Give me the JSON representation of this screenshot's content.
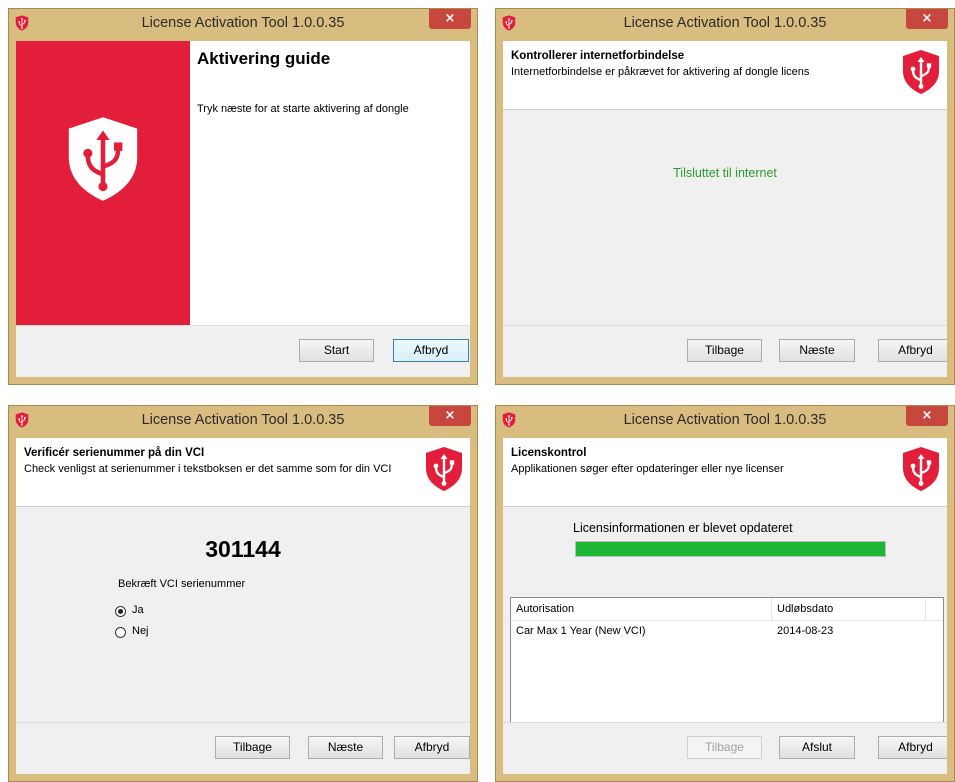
{
  "colors": {
    "brand_red": "#e31e3a",
    "progress_green": "#1db534",
    "status_green": "#2a9b2a"
  },
  "window_title": "License Activation Tool 1.0.0.35",
  "close_glyph": "×",
  "windows": [
    {
      "heading": "Aktivering guide",
      "body": "Tryk næste for at starte aktivering af dongle",
      "buttons": {
        "start": "Start",
        "cancel": "Afbryd"
      }
    },
    {
      "header_title": "Kontrollerer internetforbindelse",
      "header_subtitle": "Internetforbindelse er påkrævet for aktivering af dongle licens",
      "status": "Tilsluttet til internet",
      "buttons": {
        "back": "Tilbage",
        "next": "Næste",
        "cancel": "Afbryd"
      }
    },
    {
      "header_title": "Verificér serienummer på din VCI",
      "header_subtitle": "Check venligst at serienummer i tekstboksen er det samme som for din VCI",
      "serial_number": "301144",
      "confirm_label": "Bekræft VCI serienummer",
      "options": [
        {
          "label": "Ja",
          "checked": true
        },
        {
          "label": "Nej",
          "checked": false
        }
      ],
      "buttons": {
        "back": "Tilbage",
        "next": "Næste",
        "cancel": "Afbryd"
      }
    },
    {
      "header_title": "Licenskontrol",
      "header_subtitle": "Applikationen søger efter opdateringer eller nye licenser",
      "progress_label": "Licensinformationen er blevet opdateret",
      "progress_fraction": 1.0,
      "table": {
        "columns": [
          "Autorisation",
          "Udløbsdato"
        ],
        "rows": [
          [
            "Car Max 1 Year (New VCI)",
            "2014-08-23"
          ]
        ]
      },
      "buttons": {
        "back": "Tilbage",
        "finish": "Afslut",
        "cancel": "Afbryd"
      }
    }
  ]
}
